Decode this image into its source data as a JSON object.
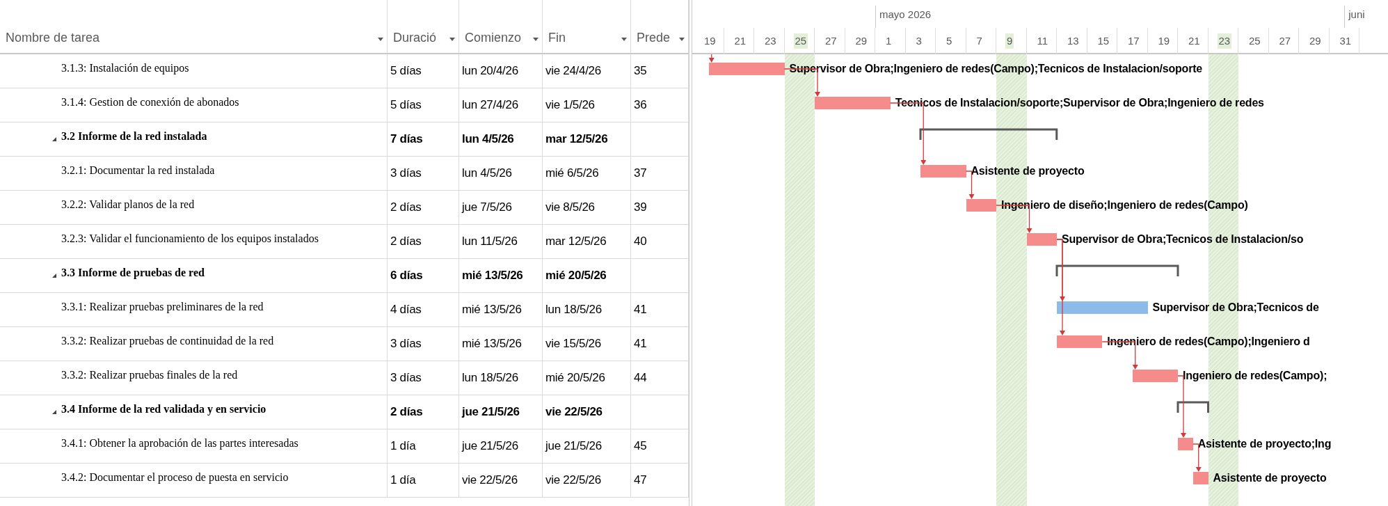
{
  "columns": [
    {
      "label": "Nombre de tarea"
    },
    {
      "label": "Duració"
    },
    {
      "label": "Comienzo"
    },
    {
      "label": "Fin"
    },
    {
      "label": "Prede"
    }
  ],
  "timescale": {
    "months": [
      {
        "label": "mayo 2026"
      },
      {
        "label": "juni"
      }
    ],
    "days": [
      {
        "label": "19",
        "shaded": false
      },
      {
        "label": "21",
        "shaded": false
      },
      {
        "label": "23",
        "shaded": false
      },
      {
        "label": "25",
        "shaded": true
      },
      {
        "label": "27",
        "shaded": false
      },
      {
        "label": "29",
        "shaded": false
      },
      {
        "label": "1",
        "shaded": false
      },
      {
        "label": "3",
        "shaded": false
      },
      {
        "label": "5",
        "shaded": false
      },
      {
        "label": "7",
        "shaded": false
      },
      {
        "label": "9",
        "shaded": true
      },
      {
        "label": "11",
        "shaded": false
      },
      {
        "label": "13",
        "shaded": false
      },
      {
        "label": "15",
        "shaded": false
      },
      {
        "label": "17",
        "shaded": false
      },
      {
        "label": "19",
        "shaded": false
      },
      {
        "label": "21",
        "shaded": false
      },
      {
        "label": "23",
        "shaded": true
      },
      {
        "label": "25",
        "shaded": false
      },
      {
        "label": "27",
        "shaded": false
      },
      {
        "label": "29",
        "shaded": false
      },
      {
        "label": "31",
        "shaded": false
      }
    ]
  },
  "tasks": [
    {
      "kind": "task",
      "name": "3.1.3: Instalación de equipos",
      "duration": "5 días",
      "start": "lun 20/4/26",
      "finish": "vie 24/4/26",
      "predecessors": "35",
      "critical": true,
      "resources": "Supervisor de Obra;Ingeniero de redes(Campo);Tecnicos de Instalacion/soporte"
    },
    {
      "kind": "task",
      "name": "3.1.4: Gestion de conexión de abonados",
      "duration": "5 días",
      "start": "lun 27/4/26",
      "finish": "vie 1/5/26",
      "predecessors": "36",
      "critical": true,
      "resources": "Tecnicos de Instalacion/soporte;Supervisor de Obra;Ingeniero de redes"
    },
    {
      "kind": "summary",
      "expanded": true,
      "name": "3.2 Informe de la red instalada",
      "duration": "7 días",
      "start": "lun 4/5/26",
      "finish": "mar 12/5/26"
    },
    {
      "kind": "task",
      "name": "3.2.1: Documentar la red instalada",
      "duration": "3 días",
      "start": "lun 4/5/26",
      "finish": "mié 6/5/26",
      "predecessors": "37",
      "critical": true,
      "resources": "Asistente de proyecto"
    },
    {
      "kind": "task",
      "name": "3.2.2: Validar planos de la red",
      "duration": "2 días",
      "start": "jue 7/5/26",
      "finish": "vie 8/5/26",
      "predecessors": "39",
      "critical": true,
      "resources": "Ingeniero de diseño;Ingeniero de redes(Campo)"
    },
    {
      "kind": "task",
      "name": "3.2.3: Validar el funcionamiento de los equipos instalados",
      "duration": "2 días",
      "start": "lun 11/5/26",
      "finish": "mar 12/5/26",
      "predecessors": "40",
      "critical": true,
      "resources": "Supervisor de Obra;Tecnicos de Instalacion/so"
    },
    {
      "kind": "summary",
      "expanded": true,
      "name": "3.3 Informe de pruebas de red",
      "duration": "6 días",
      "start": "mié 13/5/26",
      "finish": "mié 20/5/26"
    },
    {
      "kind": "task",
      "name": "3.3.1: Realizar pruebas preliminares de la red",
      "duration": "4 días",
      "start": "mié 13/5/26",
      "finish": "lun 18/5/26",
      "predecessors": "41",
      "critical": false,
      "resources": "Supervisor de Obra;Tecnicos de"
    },
    {
      "kind": "task",
      "name": "3.3.2: Realizar pruebas de continuidad de la red",
      "duration": "3 días",
      "start": "mié 13/5/26",
      "finish": "vie 15/5/26",
      "predecessors": "41",
      "critical": true,
      "resources": "Ingeniero de redes(Campo);Ingeniero d"
    },
    {
      "kind": "task",
      "name": "3.3.2: Realizar pruebas finales de la red",
      "duration": "3 días",
      "start": "lun 18/5/26",
      "finish": "mié 20/5/26",
      "predecessors": "44",
      "critical": true,
      "resources": "Ingeniero de redes(Campo);"
    },
    {
      "kind": "summary",
      "expanded": true,
      "name": "3.4 Informe de la red validada y en servicio",
      "duration": "2 días",
      "start": "jue 21/5/26",
      "finish": "vie 22/5/26"
    },
    {
      "kind": "task",
      "name": "3.4.1: Obtener la aprobación de las partes interesadas",
      "duration": "1 día",
      "start": "jue 21/5/26",
      "finish": "jue 21/5/26",
      "predecessors": "45",
      "critical": true,
      "resources": "Asistente de proyecto;Ing"
    },
    {
      "kind": "task",
      "name": "3.4.2: Documentar el proceso de puesta en servicio",
      "duration": "1 día",
      "start": "vie 22/5/26",
      "finish": "vie 22/5/26",
      "predecessors": "47",
      "critical": true,
      "resources": "Asistente de proyecto"
    }
  ]
}
